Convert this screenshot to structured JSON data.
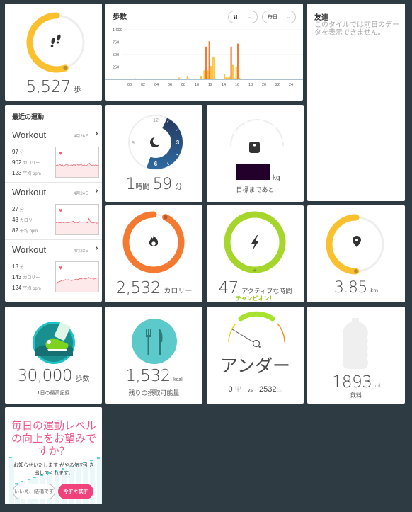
{
  "steps_tile": {
    "value": "5,527",
    "unit": "歩",
    "progress": 0.5527,
    "icon": "footsteps-icon",
    "color": "#fbc02d"
  },
  "steps_chart": {
    "title": "歩数",
    "filter_icon": "footsteps-icon",
    "period": "毎日",
    "chart_data": {
      "type": "bar",
      "title": "歩数",
      "xlabel": "",
      "ylabel": "",
      "ylim": [
        0,
        1000
      ],
      "xlim": [
        0,
        24
      ],
      "yticks": [
        "1,000",
        "750",
        "500",
        "250"
      ],
      "ytick_values": [
        1000,
        750,
        500,
        250
      ],
      "xticks": [
        "00",
        "02",
        "04",
        "06",
        "08",
        "10",
        "12",
        "14",
        "16",
        "18",
        "20",
        "22",
        "24"
      ],
      "grid": true,
      "bin_minutes": 15,
      "series": [
        {
          "name": "steps",
          "x": [
            0.75,
            1.25,
            7.25,
            8.5,
            8.75,
            9.5,
            10.5,
            11.0,
            11.25,
            11.5,
            11.75,
            12.0,
            12.25,
            12.5,
            12.75,
            14.0,
            14.25,
            14.5,
            14.75,
            15.0,
            15.25,
            15.5,
            15.75,
            16.0,
            16.25
          ],
          "values": [
            20,
            8,
            35,
            55,
            20,
            15,
            70,
            180,
            660,
            180,
            770,
            270,
            460,
            440,
            10,
            100,
            40,
            40,
            50,
            660,
            290,
            20,
            260,
            720,
            30
          ]
        }
      ],
      "colors": {
        "low": "#fbc43a",
        "high": "#f47a32",
        "threshold": 500
      }
    }
  },
  "friends": {
    "title": "友達",
    "message": "このタイルでは前日のデータを表示できません。"
  },
  "exercise": {
    "title": "最近の運動",
    "items": [
      {
        "name": "Workout",
        "date": "4月28日",
        "minutes": "97",
        "minutes_unit": "分",
        "calories": "902",
        "calories_unit": "カロリー",
        "bpm": "123",
        "bpm_unit": "平均 bpm",
        "hr": [
          52,
          53,
          51,
          54,
          52,
          53,
          50,
          52,
          54,
          53,
          52,
          51,
          53,
          52,
          54,
          52,
          55,
          53,
          52,
          54,
          53,
          52,
          53,
          51,
          52,
          54,
          56,
          53,
          52,
          53,
          52,
          53,
          52,
          51
        ]
      },
      {
        "name": "Workout",
        "date": "4月24日",
        "minutes": "27",
        "minutes_unit": "分",
        "calories": "43",
        "calories_unit": "カロリー",
        "bpm": "82",
        "bpm_unit": "平均 bpm",
        "hr": [
          52,
          53,
          52,
          52,
          53,
          52,
          53,
          52,
          52,
          53,
          53,
          55,
          52,
          53,
          52,
          54,
          53,
          53,
          54,
          53,
          52,
          60,
          53,
          52,
          52,
          53,
          51,
          52
        ]
      },
      {
        "name": "Workout",
        "date": "4月23日",
        "minutes": "13",
        "minutes_unit": "分",
        "calories": "143",
        "calories_unit": "カロリー",
        "bpm": "124",
        "bpm_unit": "平均 bpm",
        "hr": [
          46,
          48,
          49,
          50,
          52,
          51,
          53,
          52,
          53,
          52,
          51,
          52,
          53,
          54,
          53,
          55,
          54,
          56,
          55,
          54,
          56,
          57,
          55,
          56,
          54,
          55,
          56,
          55
        ]
      }
    ]
  },
  "sleep": {
    "hours": "1",
    "hours_unit": "時間",
    "minutes": "59",
    "minutes_unit": "分",
    "clock_labels": [
      "12",
      "3",
      "6",
      "9"
    ],
    "icon": "moon-icon"
  },
  "weight": {
    "unit": "kg",
    "label": "目標まであと",
    "icon": "scale-icon"
  },
  "calories": {
    "value": "2,532",
    "unit": "カロリー",
    "progress": 0.93,
    "icon": "flame-icon",
    "color": "#f47a32"
  },
  "active": {
    "value": "47",
    "unit": "アクティブな時間",
    "badge": "チャンピオン！",
    "progress": 1.0,
    "icon": "lightning-icon",
    "color": "#a6d62b"
  },
  "distance": {
    "value": "3.85",
    "unit": "km",
    "progress": 0.5,
    "icon": "location-pin-icon",
    "color": "#fbc02d"
  },
  "best_steps": {
    "value": "30,000",
    "unit": "歩数",
    "label": "1日の最高記録",
    "icon": "shoe-badge-icon"
  },
  "food_remaining": {
    "value": "1,532",
    "unit": "kcal",
    "label": "残りの摂取可能量",
    "icon": "fork-knife-icon"
  },
  "calorie_balance": {
    "status": "アンダー",
    "in": "0",
    "vs": "vs",
    "out": "2532",
    "in_icon": "fork-knife-icon",
    "out_icon": "flame-icon"
  },
  "water": {
    "value": "1893",
    "unit": "ml",
    "label": "飲料",
    "icon": "water-bottle-icon"
  },
  "promo": {
    "headline": "毎日の運動レベルの向上をお望みですか？",
    "body": "お知らせいたします がやる気を引き出してくれます。",
    "decline": "いいえ、結構です",
    "accept": "今すぐ試す"
  }
}
